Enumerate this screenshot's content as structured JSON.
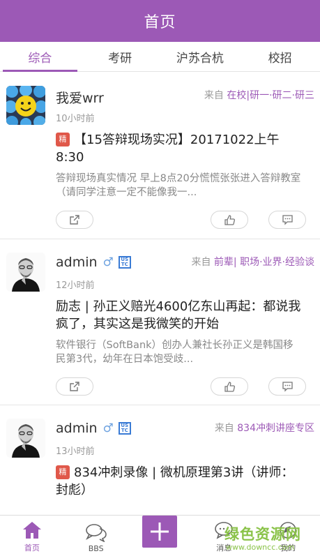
{
  "header": {
    "title": "首页"
  },
  "tabs": [
    {
      "label": "综合",
      "active": true
    },
    {
      "label": "考研",
      "active": false
    },
    {
      "label": "沪苏合杭",
      "active": false
    },
    {
      "label": "校招",
      "active": false
    }
  ],
  "posts": [
    {
      "author": "我爱wrr",
      "time": "10小时前",
      "from_label": "来自",
      "from_tags": "在校|研一·研二·研三",
      "badge": "精",
      "title": "【15答辩现场实况】20171022上午8:30",
      "excerpt": "答辩现场真实情况  早上8点20分慌慌张张进入答辩教室（请同学注意一定不能像我一..."
    },
    {
      "author": "admin",
      "gender_icon": "♂",
      "school_badge": "USTC",
      "time": "12小时前",
      "from_label": "来自",
      "from_tags": "前辈| 职场·业界·经验谈",
      "title": "励志 | 孙正义赔光4600亿东山再起：都说我疯了，其实这是我微笑的开始",
      "excerpt": "软件银行（SoftBank）创办人兼社长孙正义是韩国移民第3代，幼年在日本饱受歧..."
    },
    {
      "author": "admin",
      "gender_icon": "♂",
      "school_badge": "USTC",
      "time": "13小时前",
      "from_label": "来自",
      "from_tags": "834冲刺讲座专区",
      "badge": "精",
      "title": "834冲刺录像 | 微机原理第3讲（讲师：封彪）"
    }
  ],
  "tabbar": {
    "home": "首页",
    "bbs": "BBS",
    "messages": "消息",
    "mine": "我的"
  },
  "watermark": {
    "logo": "绿色资源网",
    "url": "www.downcc.com"
  },
  "colors": {
    "primary": "#9c59b6",
    "badge": "#e0584a",
    "gender": "#6fa3e0",
    "school": "#3a7bd5"
  }
}
